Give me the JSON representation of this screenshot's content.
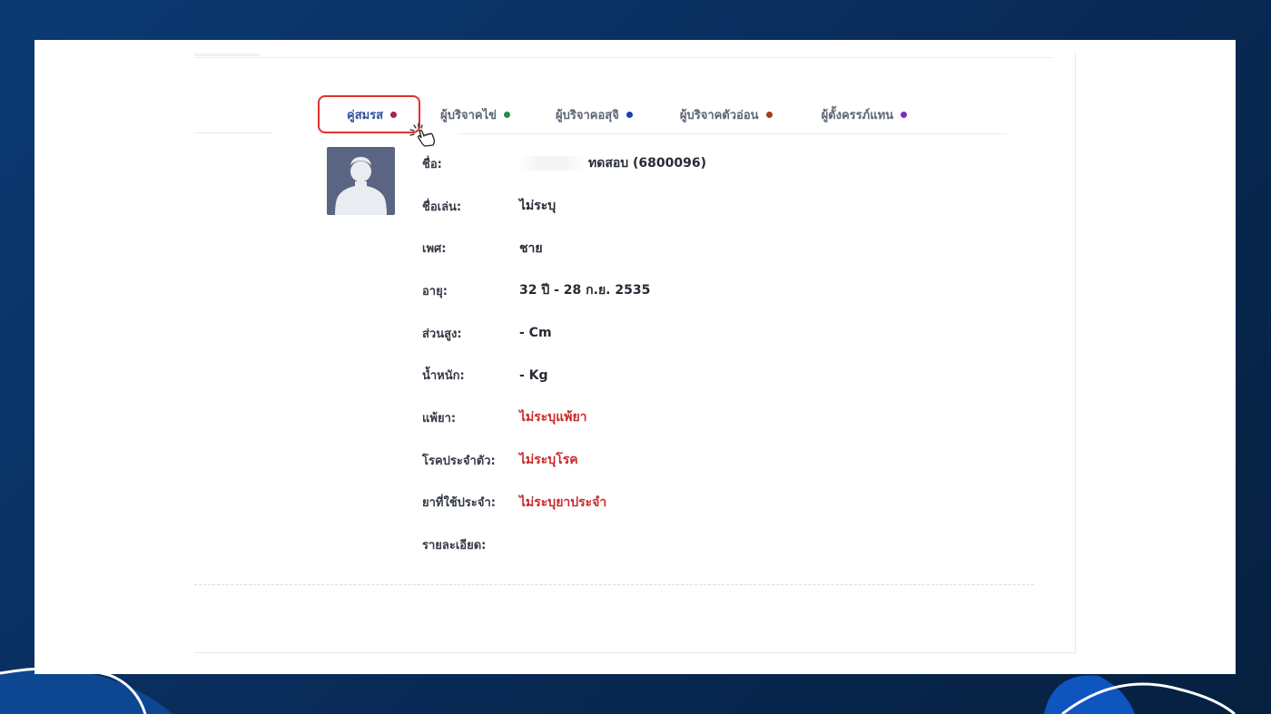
{
  "tabs": [
    {
      "label": "คู่สมรส",
      "dot": "#a3224f",
      "active": true
    },
    {
      "label": "ผู้บริจาคไข่",
      "dot": "#2b8a3e",
      "active": false
    },
    {
      "label": "ผู้บริจาคอสุจิ",
      "dot": "#1c3fb0",
      "active": false
    },
    {
      "label": "ผู้บริจาคตัวอ่อน",
      "dot": "#a33a1c",
      "active": false
    },
    {
      "label": "ผู้ตั้งครรภ์แทน",
      "dot": "#7b2fbe",
      "active": false
    }
  ],
  "profile": {
    "name_label": "ชื่อ:",
    "name_value": "ทดสอบ  (6800096)",
    "nickname_label": "ชื่อเล่น:",
    "nickname_value": "ไม่ระบุ",
    "gender_label": "เพศ:",
    "gender_value": "ชาย",
    "age_label": "อายุ:",
    "age_value": "32 ปี - 28 ก.ย. 2535",
    "height_label": "ส่วนสูง:",
    "height_value": "- Cm",
    "weight_label": "น้ำหนัก:",
    "weight_value": "- Kg",
    "allergy_label": "แพ้ยา:",
    "allergy_value": "ไม่ระบุแพ้ยา",
    "disease_label": "โรคประจำตัว:",
    "disease_value": "ไม่ระบุโรค",
    "medication_label": "ยาที่ใช้ประจำ:",
    "medication_value": "ไม่ระบุยาประจำ",
    "details_label": "รายละเอียด:",
    "details_value": ""
  },
  "colors": {
    "background": "#0a2d5c",
    "active_tab_text": "#2f4fa0",
    "highlight_border": "#e03131",
    "warning_text": "#c92a2a",
    "avatar_bg": "#5a6584"
  }
}
